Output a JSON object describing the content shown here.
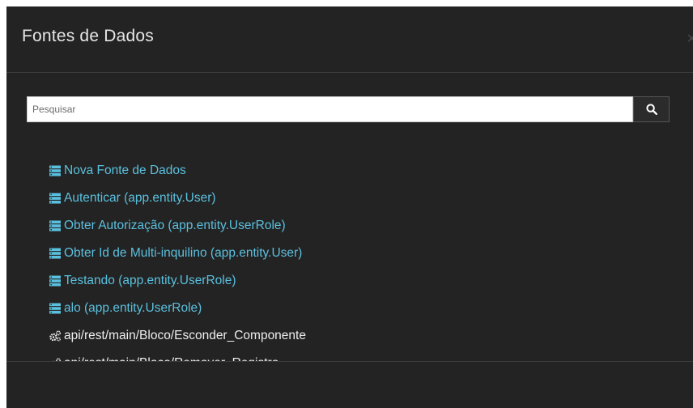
{
  "modal": {
    "title": "Fontes de Dados",
    "close_icon": "close-icon"
  },
  "search": {
    "placeholder": "Pesquisar",
    "value": "",
    "button_icon": "search-icon"
  },
  "colors": {
    "background": "#232323",
    "datasource_link": "#5bc0de",
    "api_text": "#eeeeee"
  },
  "items": [
    {
      "label": "Nova Fonte de Dados",
      "icon": "database-icon",
      "kind": "datasource"
    },
    {
      "label": "Autenticar (app.entity.User)",
      "icon": "database-icon",
      "kind": "datasource"
    },
    {
      "label": "Obter Autorização (app.entity.UserRole)",
      "icon": "database-icon",
      "kind": "datasource"
    },
    {
      "label": "Obter Id de Multi-inquilino (app.entity.User)",
      "icon": "database-icon",
      "kind": "datasource"
    },
    {
      "label": "Testando (app.entity.UserRole)",
      "icon": "database-icon",
      "kind": "datasource"
    },
    {
      "label": "alo (app.entity.UserRole)",
      "icon": "database-icon",
      "kind": "datasource"
    },
    {
      "label": "api/rest/main/Bloco/Esconder_Componente",
      "icon": "cogs-icon",
      "kind": "api"
    },
    {
      "label": "api/rest/main/Bloco/Remover_Registro",
      "icon": "cogs-icon",
      "kind": "api"
    }
  ]
}
